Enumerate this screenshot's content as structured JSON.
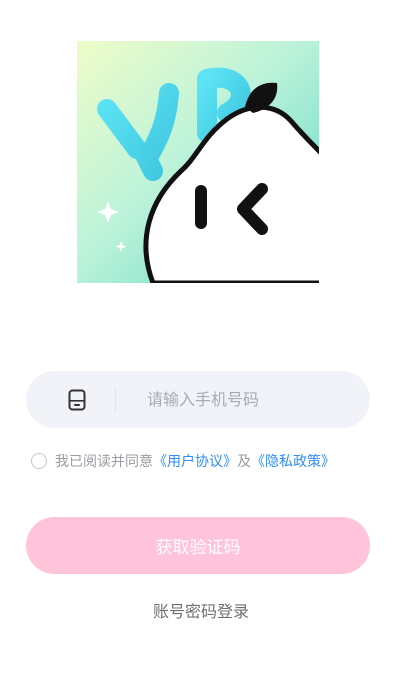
{
  "app_logo": {
    "icon": "pear-mascot-logo",
    "letters": "YP"
  },
  "phone_field": {
    "icon": "mobile-phone-icon",
    "placeholder": "请输入手机号码",
    "value": ""
  },
  "agreement": {
    "prefix": "我已阅读并同意",
    "user_agreement": "《用户协议》",
    "and": "及",
    "privacy_policy": "《隐私政策》",
    "checked": false
  },
  "get_code_button": {
    "label": "获取验证码"
  },
  "password_login_link": {
    "label": "账号密码登录"
  },
  "colors": {
    "button_disabled": "#ffc3da",
    "link": "#2f8cff",
    "input_bg": "#f2f3f8"
  }
}
